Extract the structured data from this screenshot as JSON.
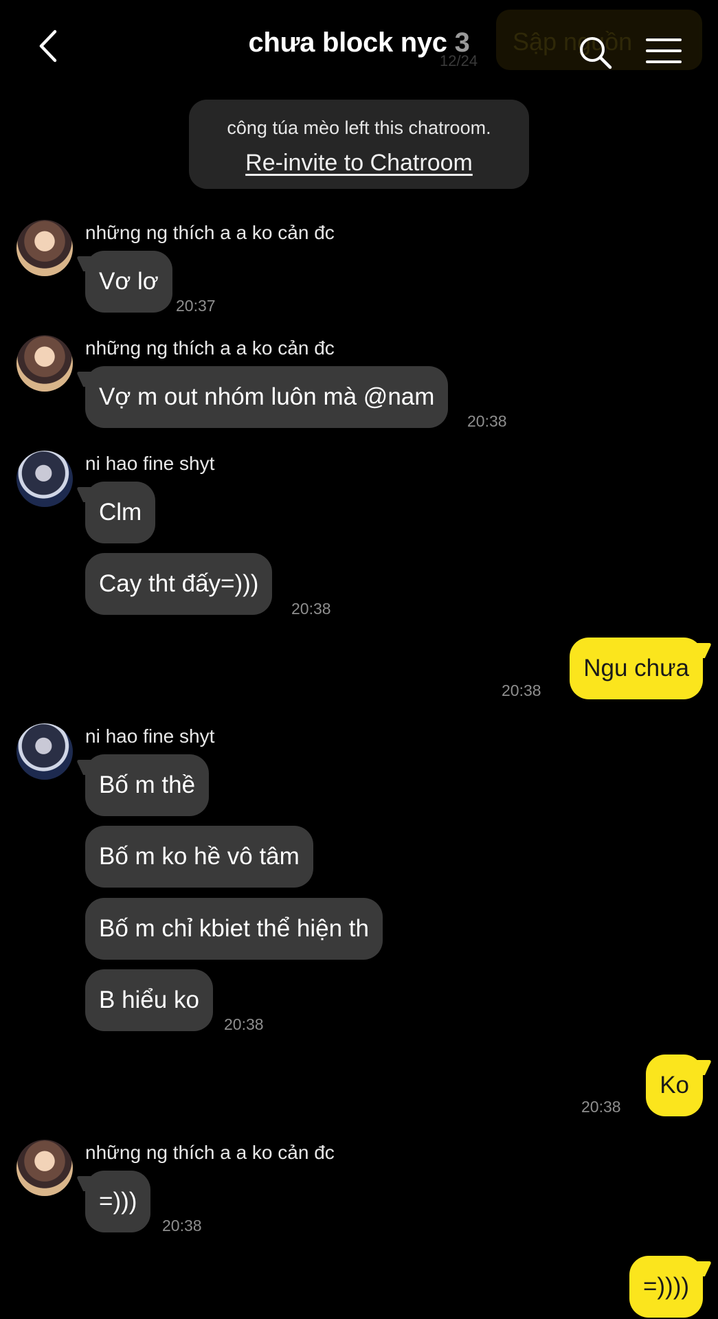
{
  "header": {
    "title": "chưa block nyc",
    "member_count": "3",
    "ghost_notice": "Sập nguồn",
    "ghost_sub": "12/24"
  },
  "system_notice": {
    "text": "công túa mèo left this chatroom.",
    "link": "Re-invite to Chatroom"
  },
  "messages": [
    {
      "sender": "những ng thích a a ko cản đc",
      "text": "Vơ lơ",
      "time": "20:37"
    },
    {
      "sender": "những ng thích a a ko cản đc",
      "text": "Vợ m out nhóm luôn mà @nam",
      "time": "20:38"
    },
    {
      "sender": "ni hao fine shyt",
      "text": "Clm"
    },
    {
      "text": "Cay tht đấy=)))",
      "time": "20:38"
    },
    {
      "mine": true,
      "text": "Ngu chưa",
      "time": "20:38"
    },
    {
      "sender": "ni hao fine shyt",
      "text": "Bố m thề"
    },
    {
      "text": "Bố m ko hề vô tâm"
    },
    {
      "text": "Bố m chỉ kbiet thể hiện th"
    },
    {
      "text": "B hiểu ko",
      "time": "20:38"
    },
    {
      "mine": true,
      "text": "Ko",
      "time": "20:38"
    },
    {
      "sender": "những ng thích a a ko cản đc",
      "text": "=)))",
      "time": "20:38"
    },
    {
      "mine": true,
      "text": "=))))"
    }
  ],
  "icons": {
    "back": "chevron-left-icon",
    "search": "search-icon",
    "menu": "hamburger-menu-icon"
  },
  "colors": {
    "background": "#000000",
    "incoming_bubble": "#3a3a3a",
    "outgoing_bubble": "#fbe51d",
    "notice_bg": "#262626",
    "timestamp": "#8e8e8e"
  }
}
